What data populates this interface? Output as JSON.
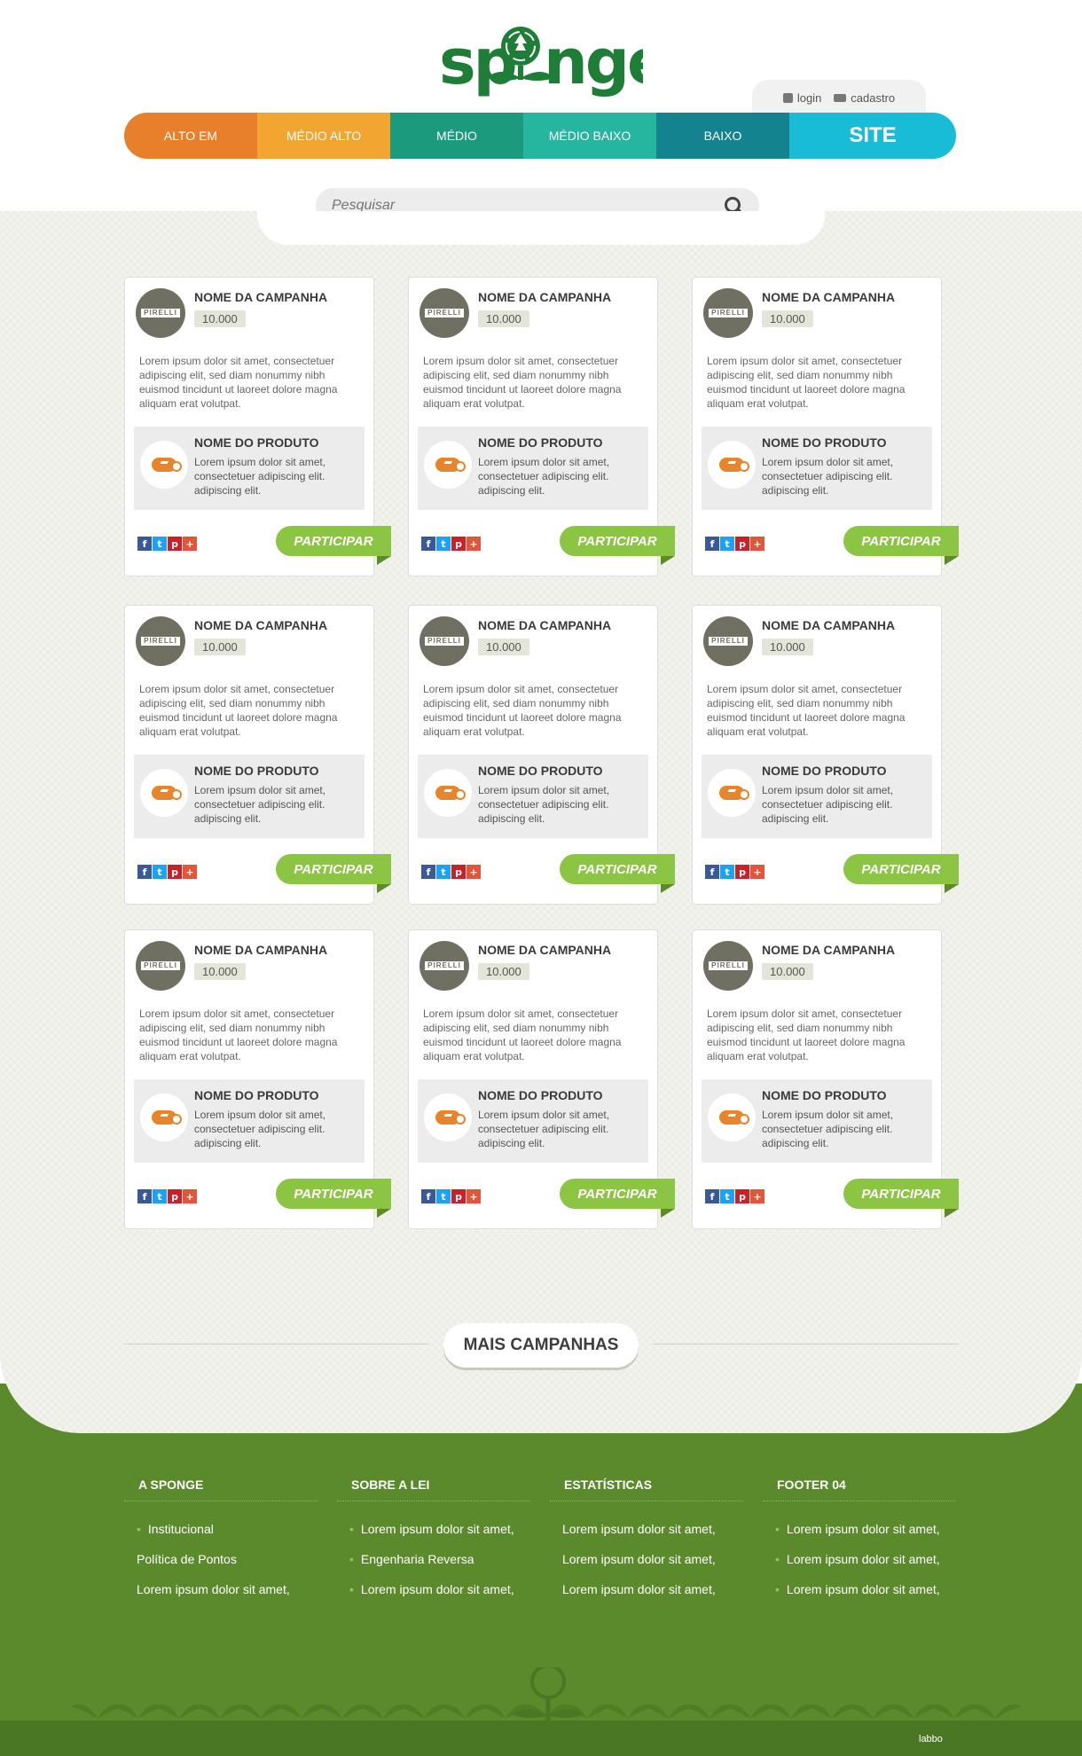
{
  "brand": {
    "name": "sponge",
    "accent": "#1e7d36"
  },
  "auth": {
    "login": "login",
    "register": "cadastro"
  },
  "nav": [
    {
      "label": "ALTO EM",
      "color": "#e8802b"
    },
    {
      "label": "MÉDIO ALTO",
      "color": "#f2a531"
    },
    {
      "label": "MÉDIO",
      "color": "#1b9a7e"
    },
    {
      "label": "MÉDIO BAIXO",
      "color": "#26b6a0"
    },
    {
      "label": "BAIXO",
      "color": "#138390"
    },
    {
      "label": "SITE",
      "color": "#18bcd6"
    }
  ],
  "search": {
    "placeholder": "Pesquisar"
  },
  "cards": {
    "campaign_title": "NOME DA CAMPANHA",
    "points": "10.000",
    "campaign_logo_text": "PIRELLI",
    "description": "Lorem ipsum dolor sit amet, consectetuer adipiscing elit, sed diam nonummy nibh euismod tincidunt ut laoreet dolore magna aliquam erat volutpat.",
    "product_title": "NOME DO PRODUTO",
    "product_description": "Lorem ipsum dolor sit amet, consectetuer adipiscing elit. adipiscing elit.",
    "button": "PARTICIPAR",
    "social": [
      "f",
      "t",
      "p",
      "+"
    ],
    "count": 9
  },
  "more_button": "MAIS CAMPANHAS",
  "footer": {
    "columns": [
      {
        "title": "A SPONGE",
        "items": [
          {
            "text": "Institucional",
            "bullet": true
          },
          {
            "text": "Política de Pontos",
            "bullet": false
          },
          {
            "text": "Lorem ipsum dolor sit amet,",
            "bullet": false
          }
        ]
      },
      {
        "title": "SOBRE A LEI",
        "items": [
          {
            "text": "Lorem ipsum dolor sit amet,",
            "bullet": true
          },
          {
            "text": "Engenharia Reversa",
            "bullet": true
          },
          {
            "text": "Lorem ipsum dolor sit amet,",
            "bullet": true
          }
        ]
      },
      {
        "title": "ESTATÍSTICAS",
        "items": [
          {
            "text": "Lorem ipsum dolor sit amet,",
            "bullet": false
          },
          {
            "text": "Lorem ipsum dolor sit amet,",
            "bullet": false
          },
          {
            "text": "Lorem ipsum dolor sit amet,",
            "bullet": false
          }
        ]
      },
      {
        "title": "FOOTER 04",
        "items": [
          {
            "text": "Lorem ipsum dolor sit amet,",
            "bullet": true
          },
          {
            "text": "Lorem ipsum dolor sit amet,",
            "bullet": true
          },
          {
            "text": "Lorem ipsum dolor sit amet,",
            "bullet": true
          }
        ]
      }
    ],
    "credit": "labbo"
  }
}
